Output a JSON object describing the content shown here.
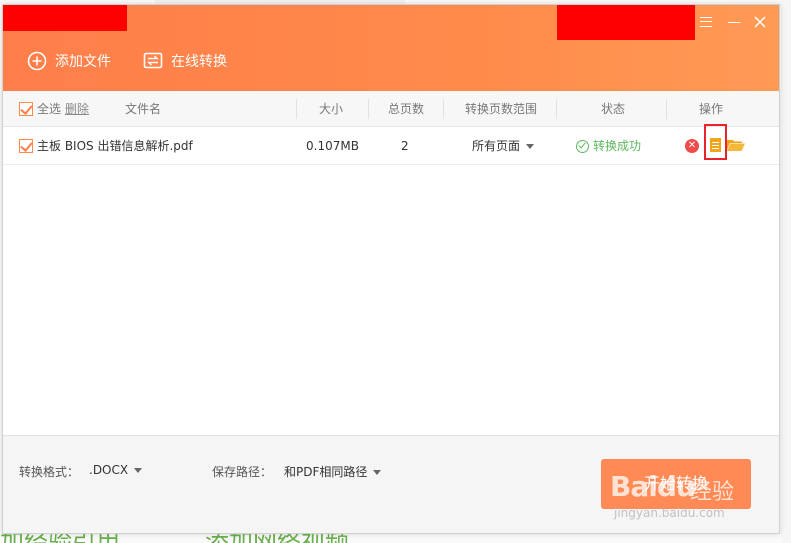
{
  "toolbar": {
    "add_file_label": "添加文件",
    "online_convert_label": "在线转换"
  },
  "table": {
    "select_all_label": "全选",
    "delete_label": "删除",
    "columns": {
      "filename": "文件名",
      "size": "大小",
      "pages": "总页数",
      "range": "转换页数范围",
      "status": "状态",
      "actions": "操作"
    },
    "rows": [
      {
        "filename": "主板 BIOS 出错信息解析.pdf",
        "size": "0.107MB",
        "pages": "2",
        "range": "所有页面",
        "status": "转换成功"
      }
    ]
  },
  "footer": {
    "format_label": "转换格式：",
    "format_value": ".DOCX",
    "save_path_label": "保存路径：",
    "save_path_value": "和PDF相同路径",
    "start_label": "开始转换"
  },
  "background": {
    "left_text": "加经验引用",
    "right_text": "添加网络视频"
  },
  "watermark": {
    "brand": "Bai",
    "brand2": "du",
    "cn": "经验",
    "url": "jingyan.baidu.com"
  },
  "colors": {
    "header_accent": "#ff7e4a",
    "success": "#5cb85c",
    "delete": "#ef4b4b",
    "highlight_box": "#e8232a"
  }
}
